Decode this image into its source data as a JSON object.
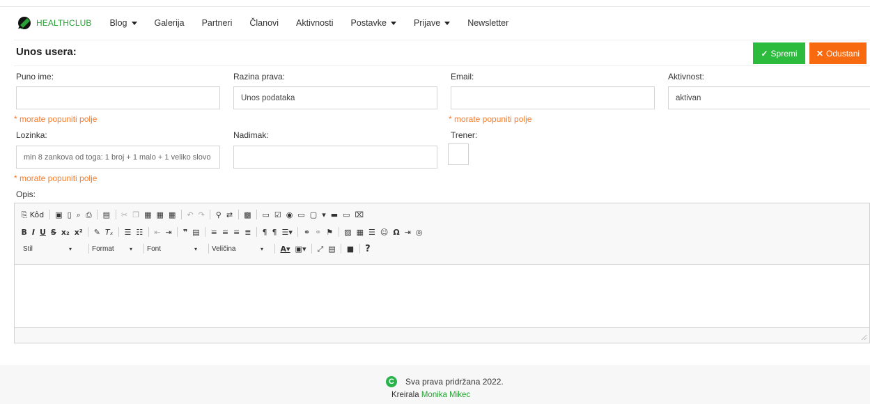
{
  "navbar": {
    "brand": "HEALTHCLUB",
    "items": [
      {
        "label": "Blog",
        "dropdown": true
      },
      {
        "label": "Galerija",
        "dropdown": false
      },
      {
        "label": "Partneri",
        "dropdown": false
      },
      {
        "label": "Članovi",
        "dropdown": false
      },
      {
        "label": "Aktivnosti",
        "dropdown": false
      },
      {
        "label": "Postavke",
        "dropdown": true
      },
      {
        "label": "Prijave",
        "dropdown": true
      },
      {
        "label": "Newsletter",
        "dropdown": false
      }
    ]
  },
  "header": {
    "title": "Unos usera:",
    "save_label": "Spremi",
    "cancel_label": "Odustani"
  },
  "form": {
    "full_name_label": "Puno ime:",
    "full_name_value": "",
    "rights_label": "Razina prava:",
    "rights_value": "Unos podataka",
    "email_label": "Email:",
    "email_value": "",
    "activity_label": "Aktivnost:",
    "activity_value": "aktivan",
    "password_label": "Lozinka:",
    "password_placeholder": "min 8 zankova od toga: 1 broj + 1 malo + 1 veliko slovo",
    "nickname_label": "Nadimak:",
    "nickname_value": "",
    "trainer_label": "Trener:",
    "description_label": "Opis:",
    "error_text": "* morate popuniti polje"
  },
  "editor": {
    "source_label": "Kôd",
    "style_label": "Stil",
    "format_label": "Format",
    "font_label": "Font",
    "size_label": "Veličina"
  },
  "footer": {
    "copyright": "Sva prava pridržana 2022.",
    "credit_prefix": "Kreirala",
    "author": "Monika Mikec"
  },
  "colors": {
    "brand_green": "#2aa136",
    "save_green": "#2cbb3d",
    "cancel_orange": "#f86a10",
    "error_orange": "#f87c2b"
  }
}
